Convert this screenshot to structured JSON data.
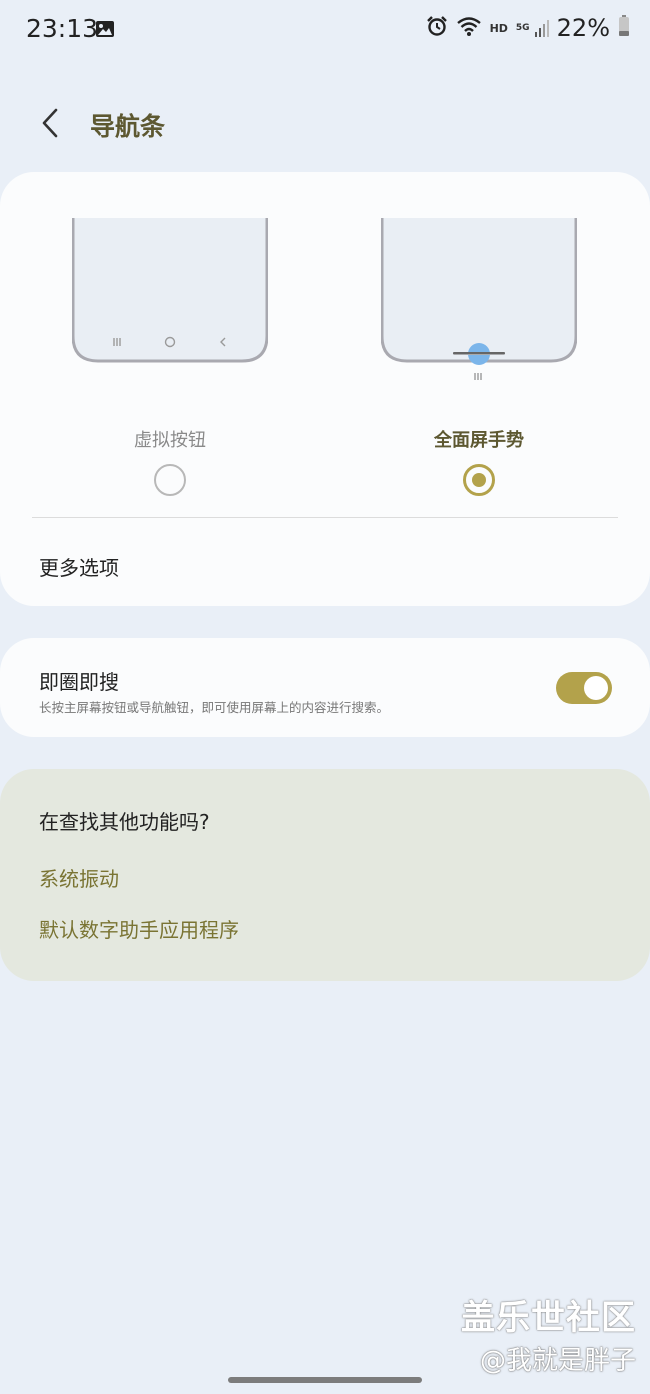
{
  "status_bar": {
    "time": "23:13",
    "battery": "22%",
    "network_hd": "HD",
    "network_gen": "5G",
    "icons": [
      "gallery-icon",
      "alarm-icon",
      "wifi-icon",
      "signal-icon",
      "battery-icon"
    ]
  },
  "header": {
    "title": "导航条",
    "back_icon": "back-arrow-icon"
  },
  "nav_card": {
    "options": [
      {
        "label": "虚拟按钮",
        "selected": false
      },
      {
        "label": "全面屏手势",
        "selected": true
      }
    ],
    "more_options": "更多选项"
  },
  "circle_search": {
    "title": "即圈即搜",
    "description": "长按主屏幕按钮或导航触钮，即可使用屏幕上的内容进行搜索。",
    "enabled": true
  },
  "find_more": {
    "title": "在查找其他功能吗?",
    "links": [
      "系统振动",
      "默认数字助手应用程序"
    ]
  },
  "watermark": {
    "logo": "盖乐世社区",
    "user": "@我就是胖子"
  },
  "colors": {
    "accent": "#b3a24b",
    "title": "#5d5831",
    "background": "#e9eff7"
  }
}
